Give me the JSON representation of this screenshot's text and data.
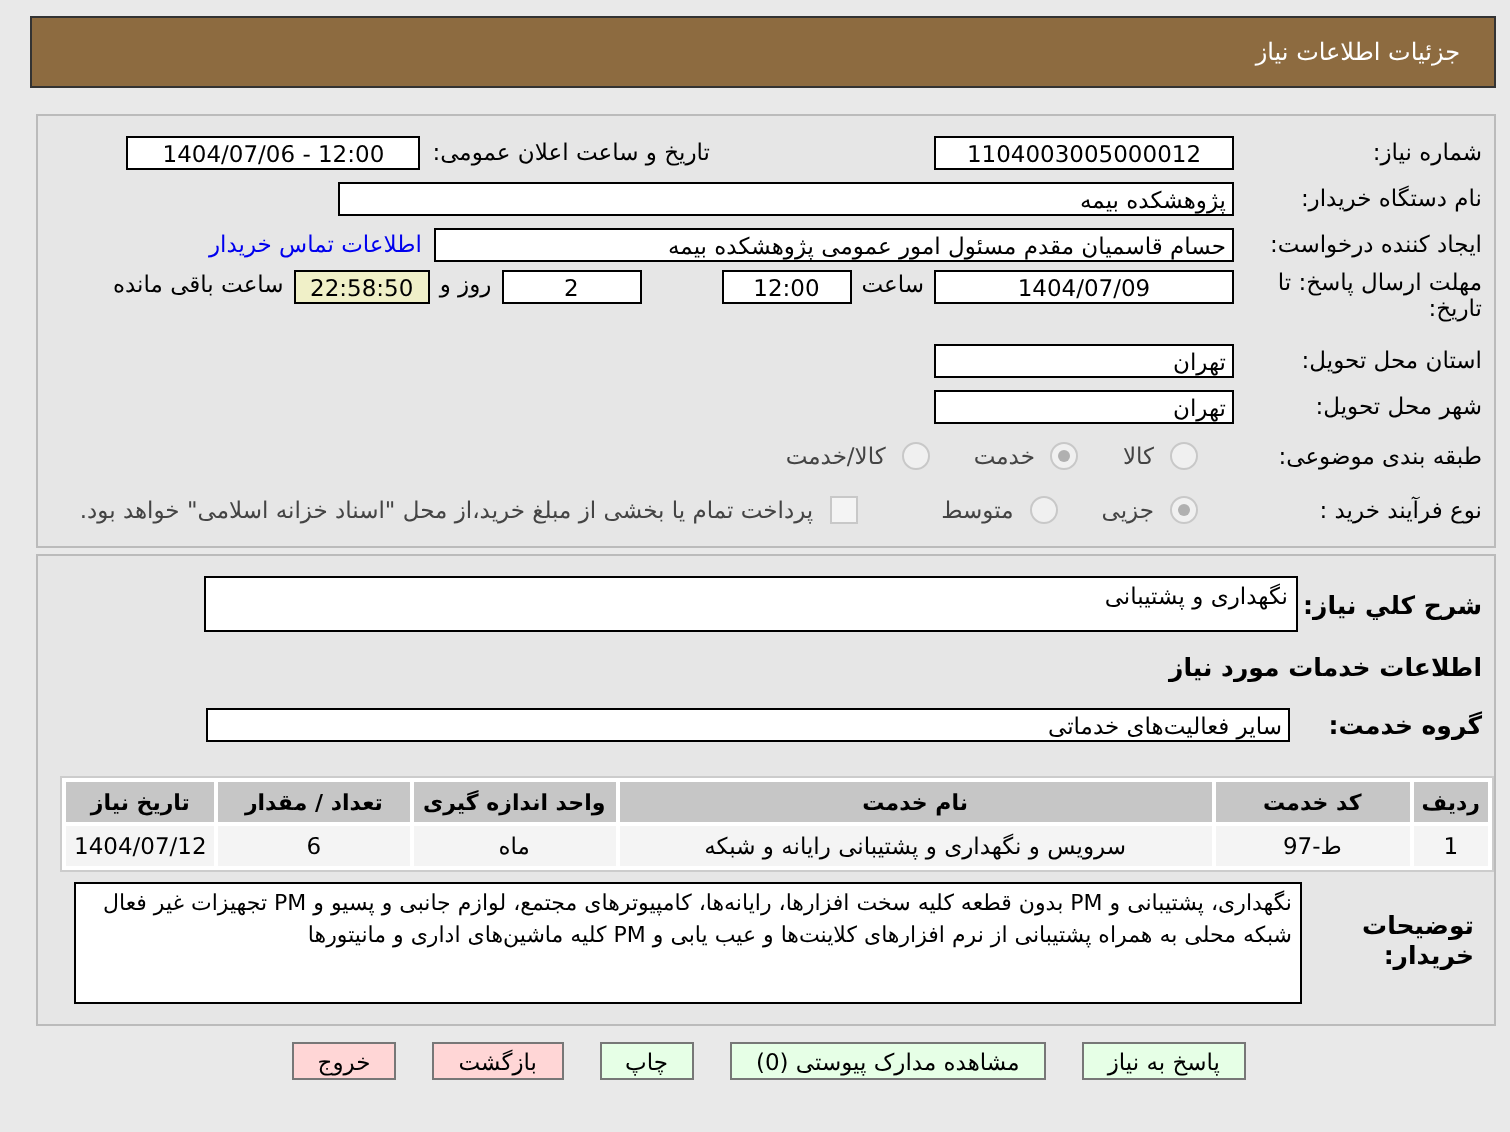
{
  "header": {
    "title": "جزئیات اطلاعات نیاز"
  },
  "need_number": {
    "label": "شماره نیاز:",
    "value": "1104003005000012"
  },
  "announce": {
    "label": "تاریخ و ساعت اعلان عمومی:",
    "value": "1404/07/06 - 12:00"
  },
  "buyer": {
    "label": "نام دستگاه خریدار:",
    "value": "پژوهشکده بیمه"
  },
  "requester": {
    "label": "ایجاد کننده درخواست:",
    "value": "حسام قاسمیان مقدم مسئول امور عمومی پژوهشکده بیمه",
    "link": "اطلاعات تماس خریدار"
  },
  "deadline": {
    "label": "مهلت ارسال پاسخ: تا تاریخ:",
    "date": "1404/07/09",
    "time_label": "ساعت",
    "time": "12:00",
    "days": "2",
    "days_label": "روز و",
    "remaining": "22:58:50",
    "remaining_label": "ساعت باقی مانده"
  },
  "province": {
    "label": "استان محل تحویل:",
    "value": "تهران"
  },
  "city": {
    "label": "شهر محل تحویل:",
    "value": "تهران"
  },
  "category": {
    "label": "طبقه بندی موضوعی:",
    "options": [
      {
        "label": "کالا",
        "selected": false
      },
      {
        "label": "خدمت",
        "selected": true
      },
      {
        "label": "کالا/خدمت",
        "selected": false
      }
    ]
  },
  "process": {
    "label": "نوع فرآیند خرید :",
    "options": [
      {
        "label": "جزیی",
        "selected": true
      },
      {
        "label": "متوسط",
        "selected": false
      }
    ],
    "payment": {
      "checked": false,
      "label": "پرداخت تمام یا بخشی از مبلغ خرید،از محل \"اسناد خزانه اسلامی\" خواهد بود."
    }
  },
  "summary": {
    "label": "شرح کلي نياز:",
    "value": "نگهداری و پشتیبانی"
  },
  "services_title": "اطلاعات خدمات مورد نیاز",
  "service_group": {
    "label": "گروه خدمت:",
    "value": "سایر فعالیت‌های خدماتی"
  },
  "table": {
    "columns": [
      "ردیف",
      "کد خدمت",
      "نام خدمت",
      "واحد اندازه گیری",
      "تعداد / مقدار",
      "تاریخ نیاز"
    ],
    "rows": [
      [
        "1",
        "ط-97",
        "سرویس و نگهداری و پشتیبانی رایانه و شبکه",
        "ماه",
        "6",
        "1404/07/12"
      ]
    ]
  },
  "description": {
    "label": "توضیحات خریدار:",
    "value": "نگهداری، پشتیبانی و PM  بدون قطعه کلیه سخت افزارها، رایانه‌ها، کامپیوترهای مجتمع، لوازم جانبی و پسیو و PM تجهیزات غیر فعال شبکه محلی به همراه پشتیبانی از نرم افزارهای کلاینت‌ها و عیب یابی و PM کلیه ماشین‌های اداری و مانیتورها"
  },
  "buttons": [
    {
      "label": "پاسخ به نیاز",
      "kind": "go"
    },
    {
      "label": "مشاهده مدارک پیوستی (0)",
      "kind": "go"
    },
    {
      "label": "چاپ",
      "kind": "go"
    },
    {
      "label": "بازگشت",
      "kind": "stop"
    },
    {
      "label": "خروج",
      "kind": "stop"
    }
  ]
}
